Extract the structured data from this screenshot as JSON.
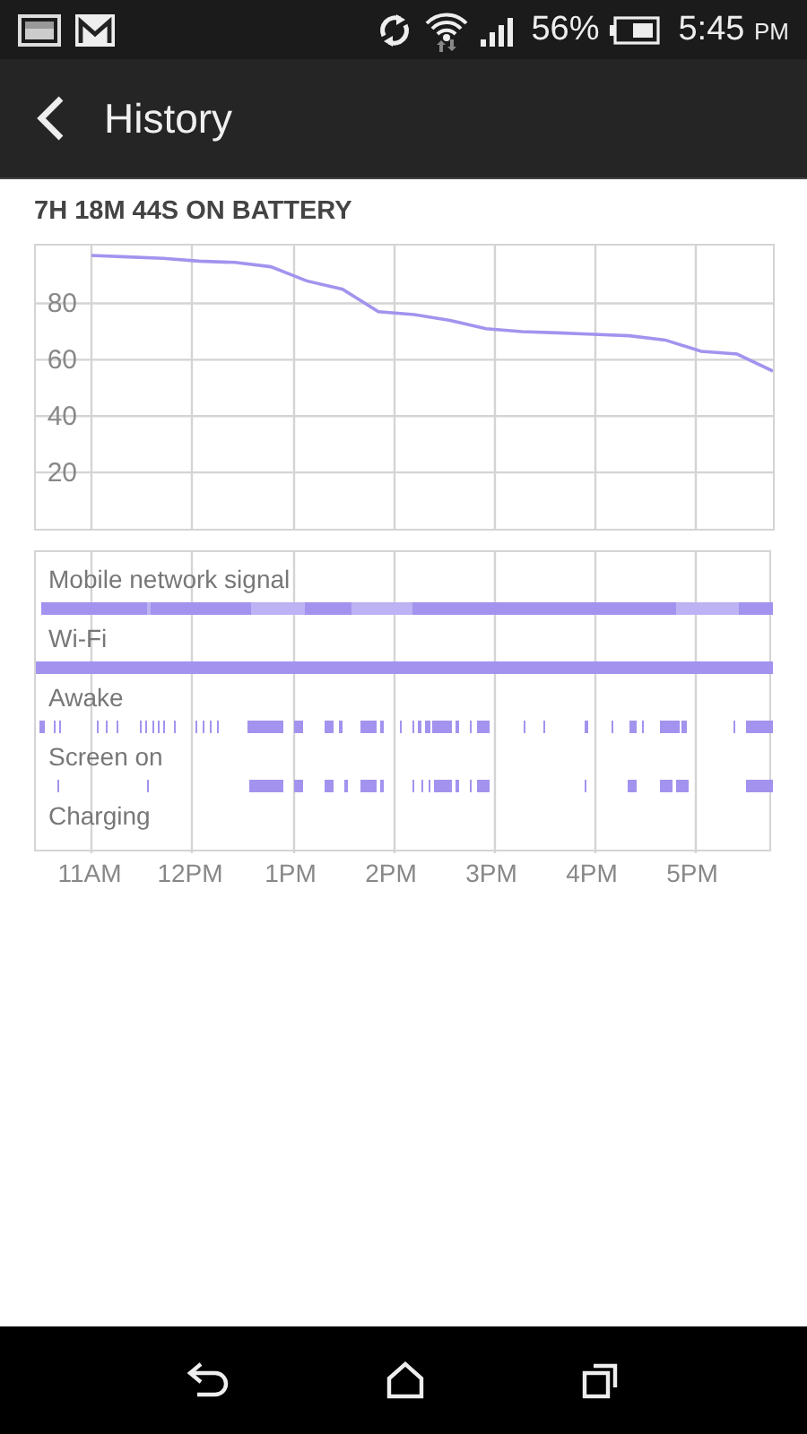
{
  "status_bar": {
    "battery_percent": "56%",
    "time": "5:45",
    "time_suffix": "PM"
  },
  "header": {
    "title": "History"
  },
  "summary": "7H 18M 44S ON BATTERY",
  "battery_chart": {
    "chart_data": {
      "type": "line",
      "categories": [
        null,
        null,
        null,
        null,
        null,
        null,
        null,
        null,
        null,
        null,
        null,
        null,
        null,
        null,
        null,
        null,
        null,
        null,
        null,
        null
      ],
      "series": [
        {
          "color": "#a393ee",
          "values": [
            97,
            96.5,
            96,
            95,
            94.5,
            93,
            88,
            85,
            77,
            76,
            74,
            71,
            70,
            69.5,
            69,
            68.5,
            67,
            63,
            62,
            56
          ]
        }
      ],
      "ylim": [
        0,
        100
      ],
      "grid": true,
      "yticks": [
        {
          "value": 20,
          "label": "20"
        },
        {
          "value": 40,
          "label": "40"
        },
        {
          "value": 60,
          "label": "60"
        },
        {
          "value": 80,
          "label": "80"
        }
      ]
    }
  },
  "timeline": {
    "rows": [
      {
        "label": "Mobile network signal",
        "kind": "signal"
      },
      {
        "label": "Wi-Fi",
        "kind": "wifi"
      },
      {
        "label": "Awake",
        "kind": "awake"
      },
      {
        "label": "Screen on",
        "kind": "screen"
      },
      {
        "label": "Charging",
        "kind": "charging"
      }
    ],
    "time_labels": [
      "11AM",
      "12PM",
      "1PM",
      "2PM",
      "3PM",
      "4PM",
      "5PM"
    ]
  }
}
